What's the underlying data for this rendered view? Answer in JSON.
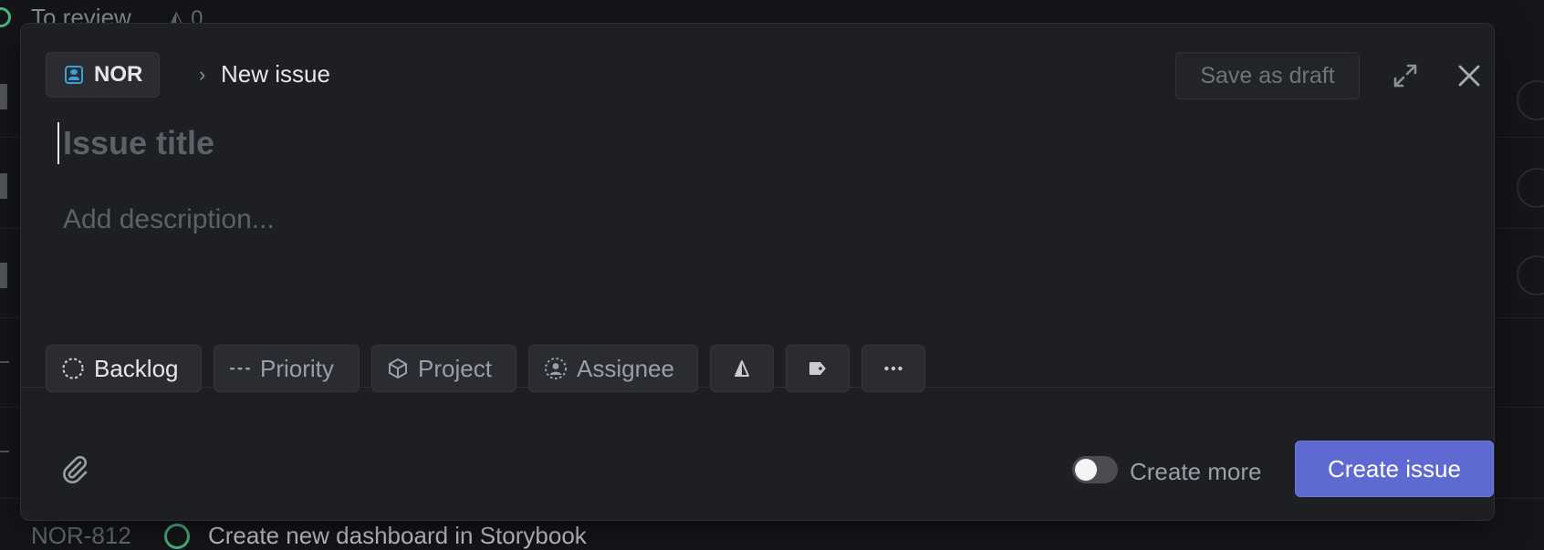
{
  "background": {
    "group_label": "To review",
    "group_count": "0",
    "footer_issue_id": "NOR-812",
    "footer_issue_title": "Create new dashboard in Storybook"
  },
  "modal": {
    "team_key": "NOR",
    "breadcrumb_separator": "›",
    "breadcrumb_title": "New issue",
    "save_draft_label": "Save as draft",
    "title_placeholder": "Issue title",
    "description_placeholder": "Add description...",
    "properties": {
      "status": "Backlog",
      "priority": "Priority",
      "project": "Project",
      "assignee": "Assignee"
    },
    "create_more_label": "Create more",
    "create_more_enabled": false,
    "create_button_label": "Create issue"
  },
  "icons": {
    "team": "team-icon",
    "expand": "expand-icon",
    "close": "close-icon",
    "status": "backlog-status-icon",
    "priority": "no-priority-icon",
    "project": "project-cube-icon",
    "assignee": "assignee-icon",
    "estimate": "estimate-icon",
    "label": "label-tag-icon",
    "more": "more-ellipsis-icon",
    "attach": "paperclip-icon"
  },
  "colors": {
    "accent": "#5e6ad2",
    "team_icon": "#3a9fdc",
    "status_done": "#4cb782"
  }
}
